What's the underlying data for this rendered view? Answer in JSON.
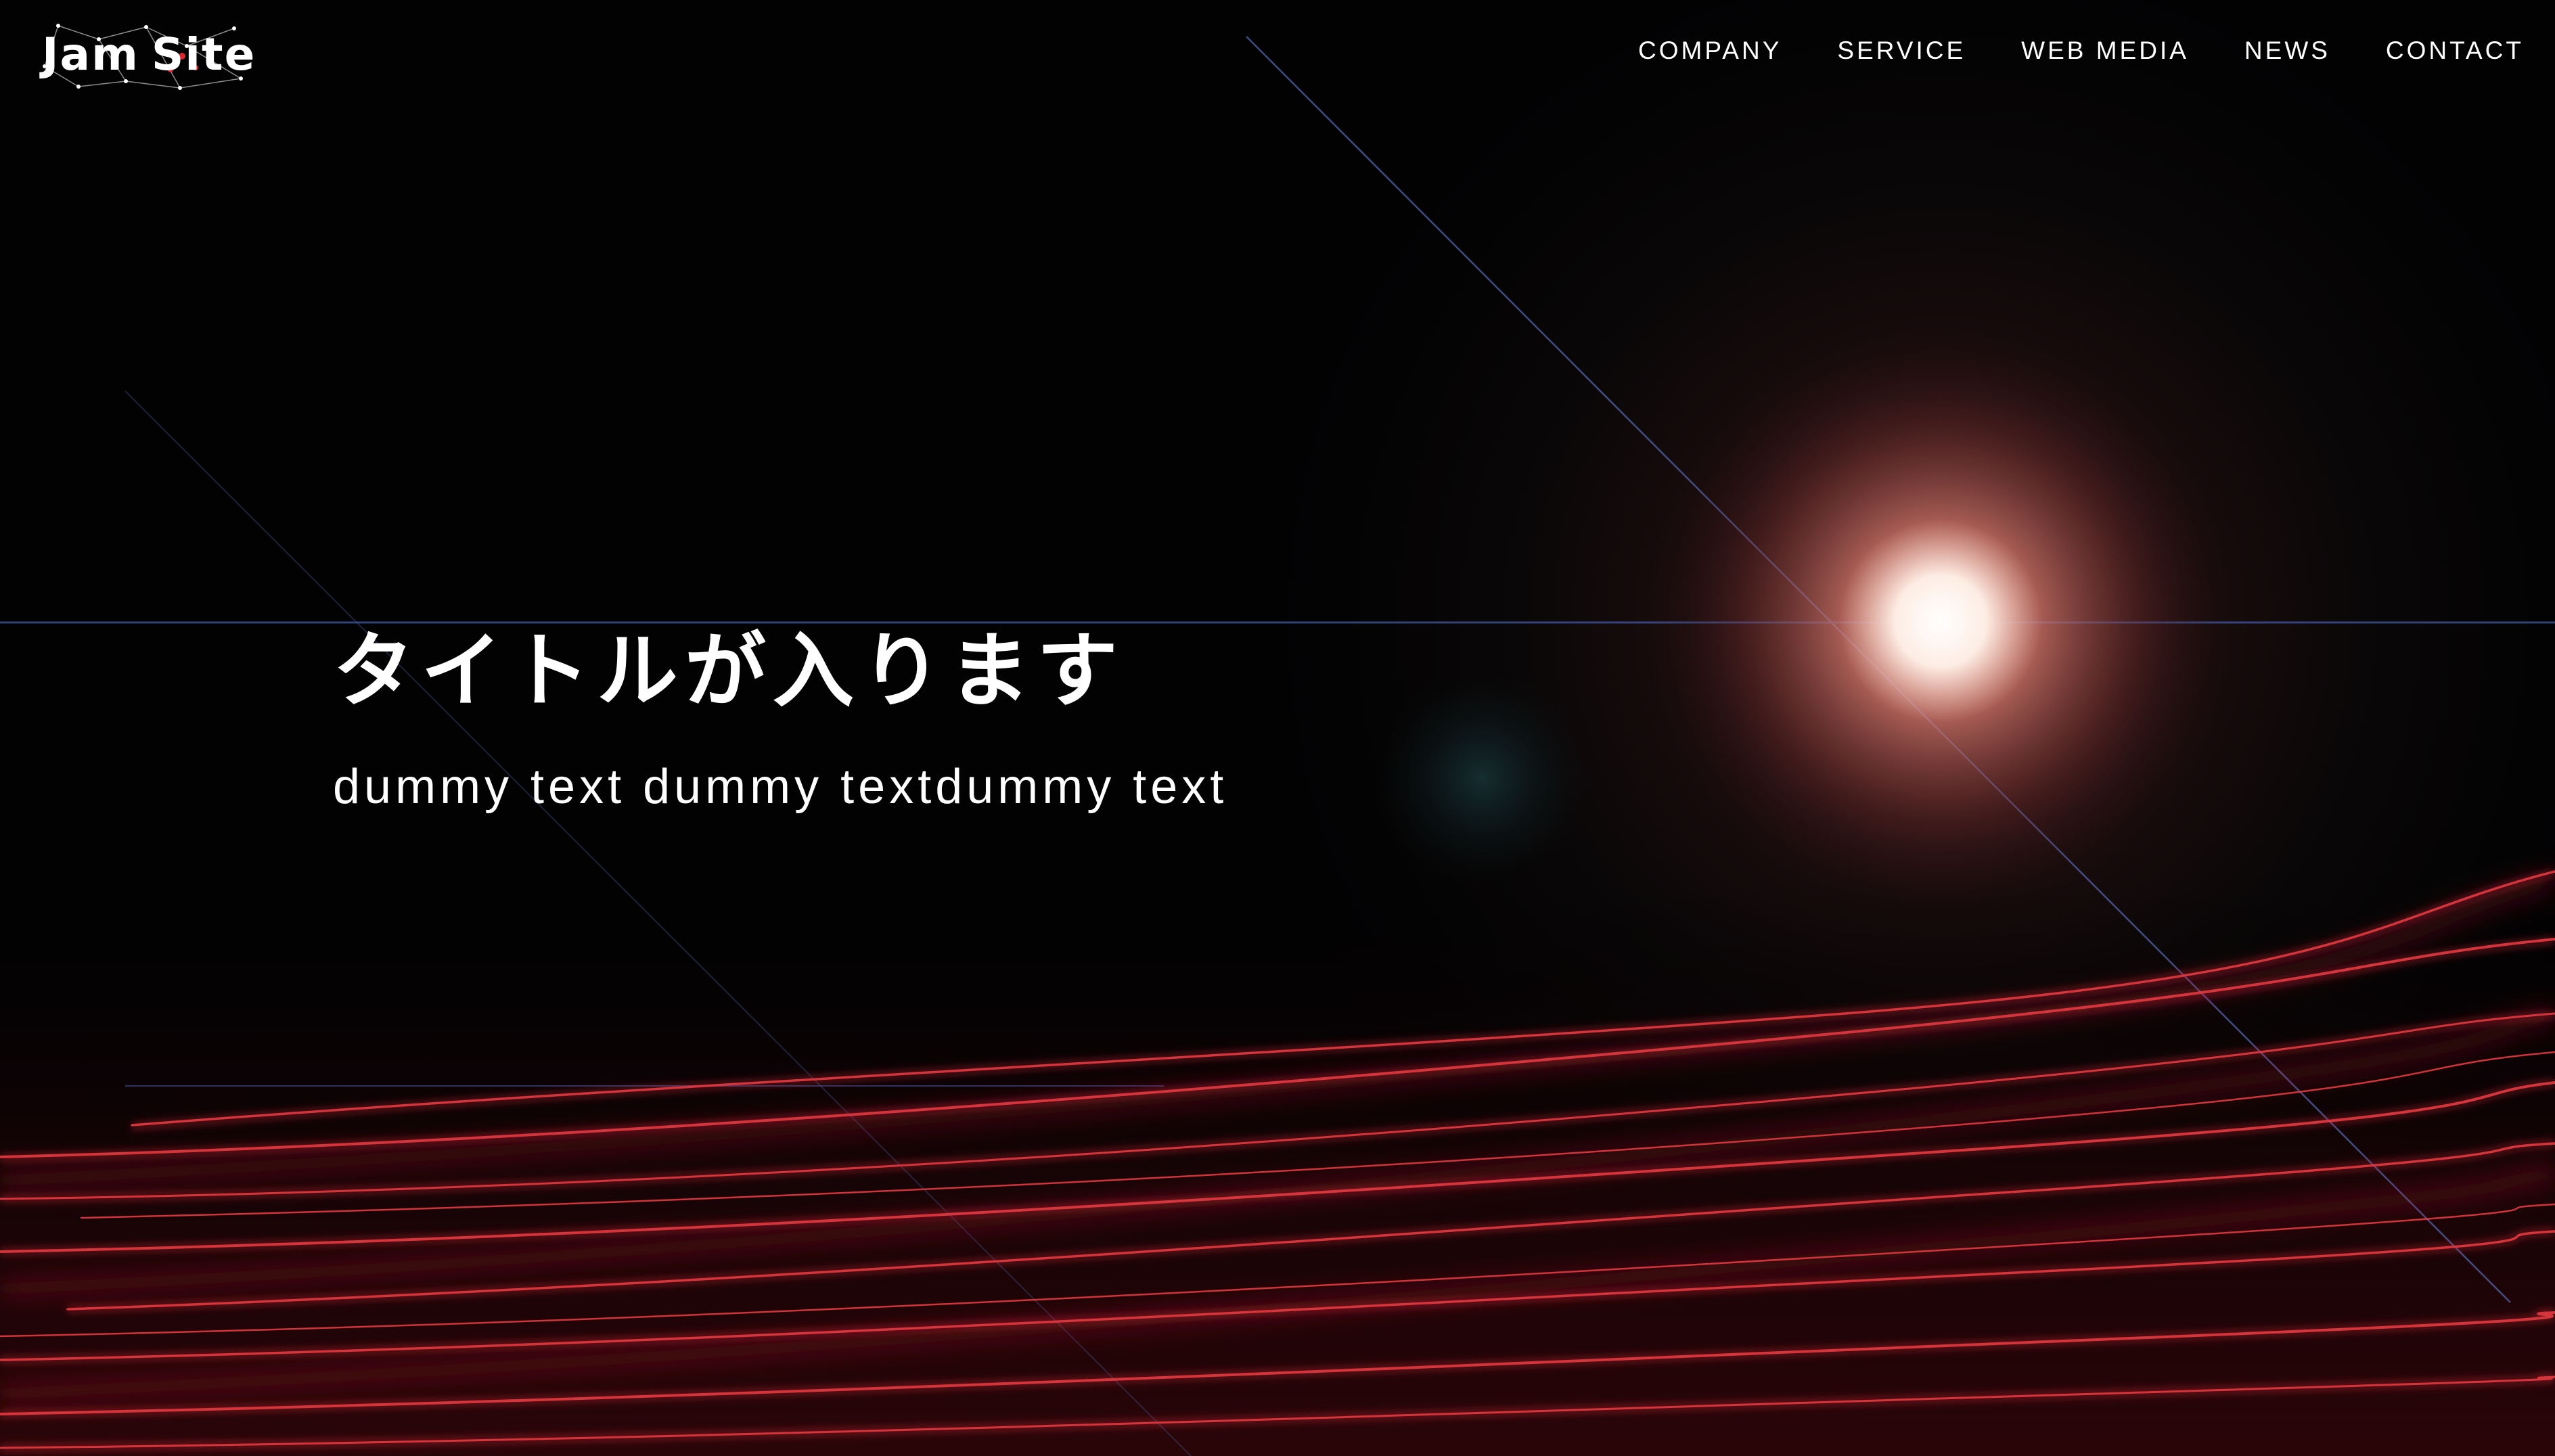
{
  "header": {
    "logo": {
      "word1": "Jam",
      "word2": "Site"
    },
    "nav": [
      {
        "label": "COMPANY"
      },
      {
        "label": "SERVICE"
      },
      {
        "label": "WEB MEDIA"
      },
      {
        "label": "NEWS"
      },
      {
        "label": "CONTACT"
      }
    ]
  },
  "hero": {
    "title": "タイトルが入ります",
    "subtitle": "dummy text dummy textdummy text"
  },
  "colors": {
    "background": "#020203",
    "text": "#ffffff",
    "accent_red": "#c8262c",
    "glow_core": "#fff3ec",
    "light_line_blue": "#4a5a9a"
  }
}
